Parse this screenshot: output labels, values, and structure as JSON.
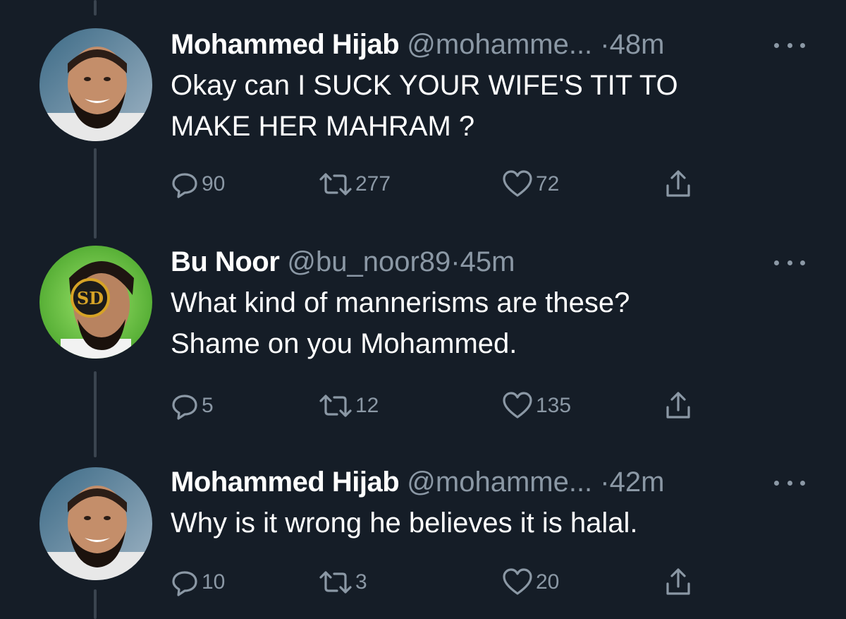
{
  "tweets": [
    {
      "author_name": "Mohammed Hijab",
      "handle": "@mohamme...",
      "separator": "·",
      "time": "48m",
      "text_lines": [
        "Okay can I SUCK YOUR WIFE'S TIT TO",
        "MAKE HER MAHRAM ?"
      ],
      "replies": "90",
      "retweets": "277",
      "likes": "72",
      "avatar_icon": "profile-photo-bearded-man"
    },
    {
      "author_name": "Bu Noor",
      "handle": "@bu_noor89",
      "separator": "·",
      "time": "45m",
      "text_lines": [
        "What kind of mannerisms are these?",
        "Shame on you Mohammed."
      ],
      "replies": "5",
      "retweets": "12",
      "likes": "135",
      "avatar_icon": "profile-photo-with-sd-logo"
    },
    {
      "author_name": "Mohammed Hijab",
      "handle": "@mohamme...",
      "separator": "·",
      "time": "42m",
      "text_lines": [
        "Why is it wrong he believes it is halal."
      ],
      "replies": "10",
      "retweets": "3",
      "likes": "20",
      "avatar_icon": "profile-photo-bearded-man"
    }
  ],
  "colors": {
    "background": "#151d27",
    "text_primary": "#ffffff",
    "text_secondary": "#8b98a5",
    "thread_line": "#3a444f"
  }
}
